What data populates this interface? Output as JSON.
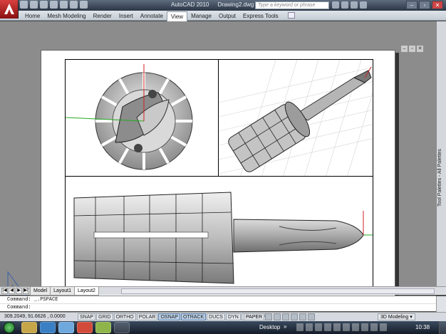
{
  "titlebar": {
    "app_name": "AutoCAD 2010",
    "document": "Drawing2.dwg",
    "search_placeholder": "Type a keyword or phrase"
  },
  "ribbon": {
    "tabs": [
      "Home",
      "Mesh Modeling",
      "Render",
      "Insert",
      "Annotate",
      "View",
      "Manage",
      "Output",
      "Express Tools"
    ],
    "active_tab": "View"
  },
  "palette": {
    "label": "Tool Palettes - All Palettes"
  },
  "layout_tabs": {
    "tabs": [
      "Model",
      "Layout1",
      "Layout2"
    ],
    "active": "Layout2"
  },
  "command_line": {
    "line1": "Command: _.PSPACE",
    "line2": "Command:"
  },
  "status_bar": {
    "coordinates": "309.2049, 91.6626 , 0.0000",
    "toggles": [
      "SNAP",
      "GRID",
      "ORTHO",
      "POLAR",
      "OSNAP",
      "OTRACK",
      "DUCS",
      "DYN",
      "LWT",
      "QP"
    ],
    "active_toggles": [
      "OSNAP",
      "OTRACK"
    ],
    "paper_mode": "PAPER",
    "workspace": "3D Modeling"
  },
  "taskbar": {
    "desktop_label": "Desktop",
    "clock": "10:38"
  },
  "colors": {
    "titlebar": "#2b3646",
    "paper": "#ffffff",
    "workspace_bg": "#8c8c8c",
    "accent_active": "#b9cde4"
  }
}
